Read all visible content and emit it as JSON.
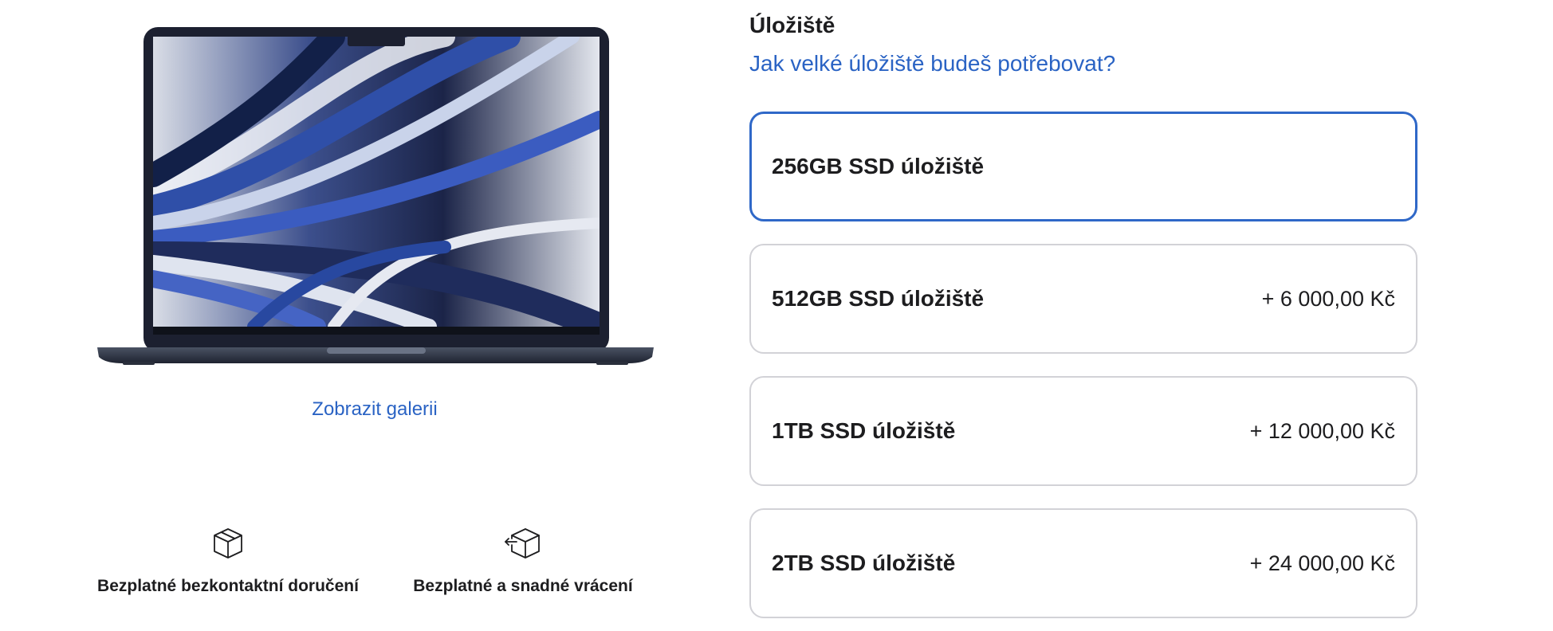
{
  "gallery": {
    "link": "Zobrazit galerii"
  },
  "benefits": [
    {
      "icon": "package-icon",
      "label": "Bezplatné bezkontaktní doručení"
    },
    {
      "icon": "package-return-icon",
      "label": "Bezplatné a snadné vrácení"
    }
  ],
  "storage": {
    "title": "Úložiště",
    "help_link": "Jak velké úložiště budeš potřebovat?",
    "selected_index": 0,
    "options": [
      {
        "name": "256GB SSD úložiště",
        "price": ""
      },
      {
        "name": "512GB SSD úložiště",
        "price": "+ 6 000,00 Kč"
      },
      {
        "name": "1TB SSD úložiště",
        "price": "+ 12 000,00 Kč"
      },
      {
        "name": "2TB SSD úložiště",
        "price": "+ 24 000,00 Kč"
      }
    ]
  },
  "colors": {
    "accent": "#2a63c4",
    "selected_border": "#2f68c8",
    "border": "#d2d2d7",
    "text": "#1d1d1f"
  }
}
